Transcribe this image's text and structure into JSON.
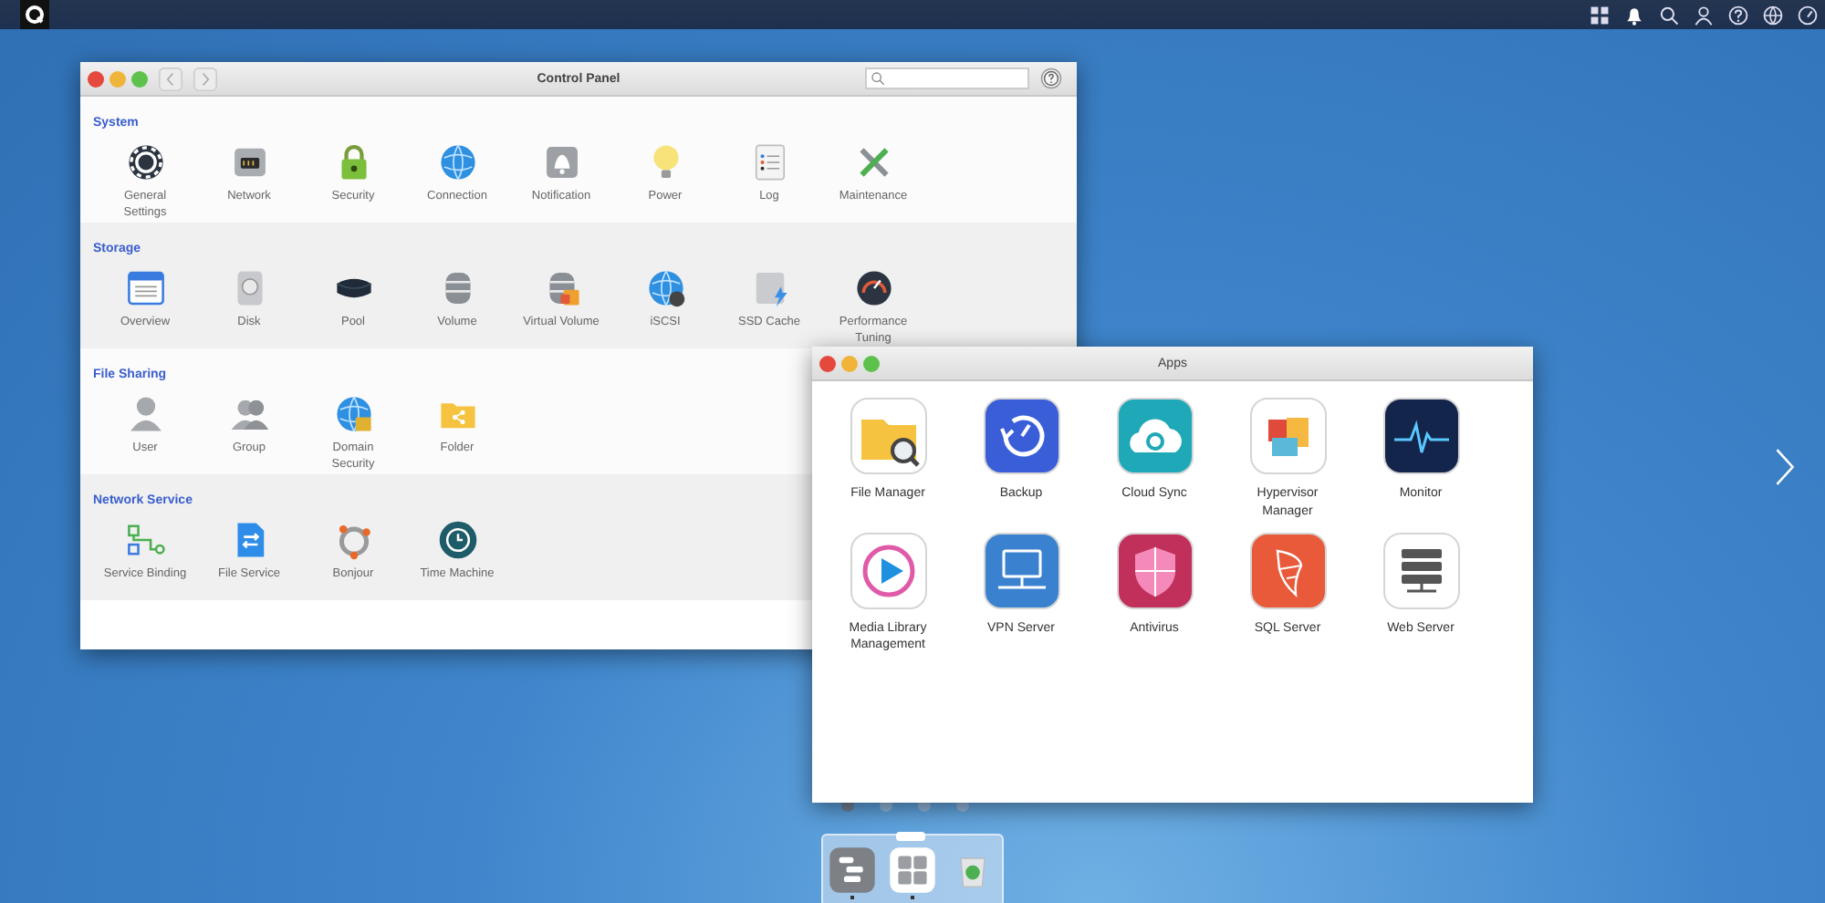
{
  "control_panel": {
    "title": "Control Panel",
    "sections": [
      {
        "title": "System",
        "items": [
          {
            "label": "General Settings"
          },
          {
            "label": "Network"
          },
          {
            "label": "Security"
          },
          {
            "label": "Connection"
          },
          {
            "label": "Notification"
          },
          {
            "label": "Power"
          },
          {
            "label": "Log"
          },
          {
            "label": "Maintenance"
          }
        ]
      },
      {
        "title": "Storage",
        "items": [
          {
            "label": "Overview"
          },
          {
            "label": "Disk"
          },
          {
            "label": "Pool"
          },
          {
            "label": "Volume"
          },
          {
            "label": "Virtual Volume"
          },
          {
            "label": "iSCSI"
          },
          {
            "label": "SSD Cache"
          },
          {
            "label": "Performance Tuning"
          }
        ]
      },
      {
        "title": "File Sharing",
        "items": [
          {
            "label": "User"
          },
          {
            "label": "Group"
          },
          {
            "label": "Domain Security"
          },
          {
            "label": "Folder"
          }
        ]
      },
      {
        "title": "Network Service",
        "items": [
          {
            "label": "Service Binding"
          },
          {
            "label": "File Service"
          },
          {
            "label": "Bonjour"
          },
          {
            "label": "Time Machine"
          }
        ]
      }
    ]
  },
  "apps_window": {
    "title": "Apps",
    "apps": [
      {
        "label": "File Manager"
      },
      {
        "label": "Backup"
      },
      {
        "label": "Cloud Sync"
      },
      {
        "label": "Hypervisor Manager"
      },
      {
        "label": "Monitor"
      },
      {
        "label": "Media Library Management"
      },
      {
        "label": "VPN Server"
      },
      {
        "label": "Antivirus"
      },
      {
        "label": "SQL Server"
      },
      {
        "label": "Web Server"
      }
    ]
  },
  "page_dots": [
    {
      "selected": true
    },
    {
      "selected": false
    },
    {
      "selected": false
    },
    {
      "selected": false
    }
  ],
  "dock": [
    {
      "running": true
    },
    {
      "running": true
    },
    {
      "running": false
    }
  ]
}
